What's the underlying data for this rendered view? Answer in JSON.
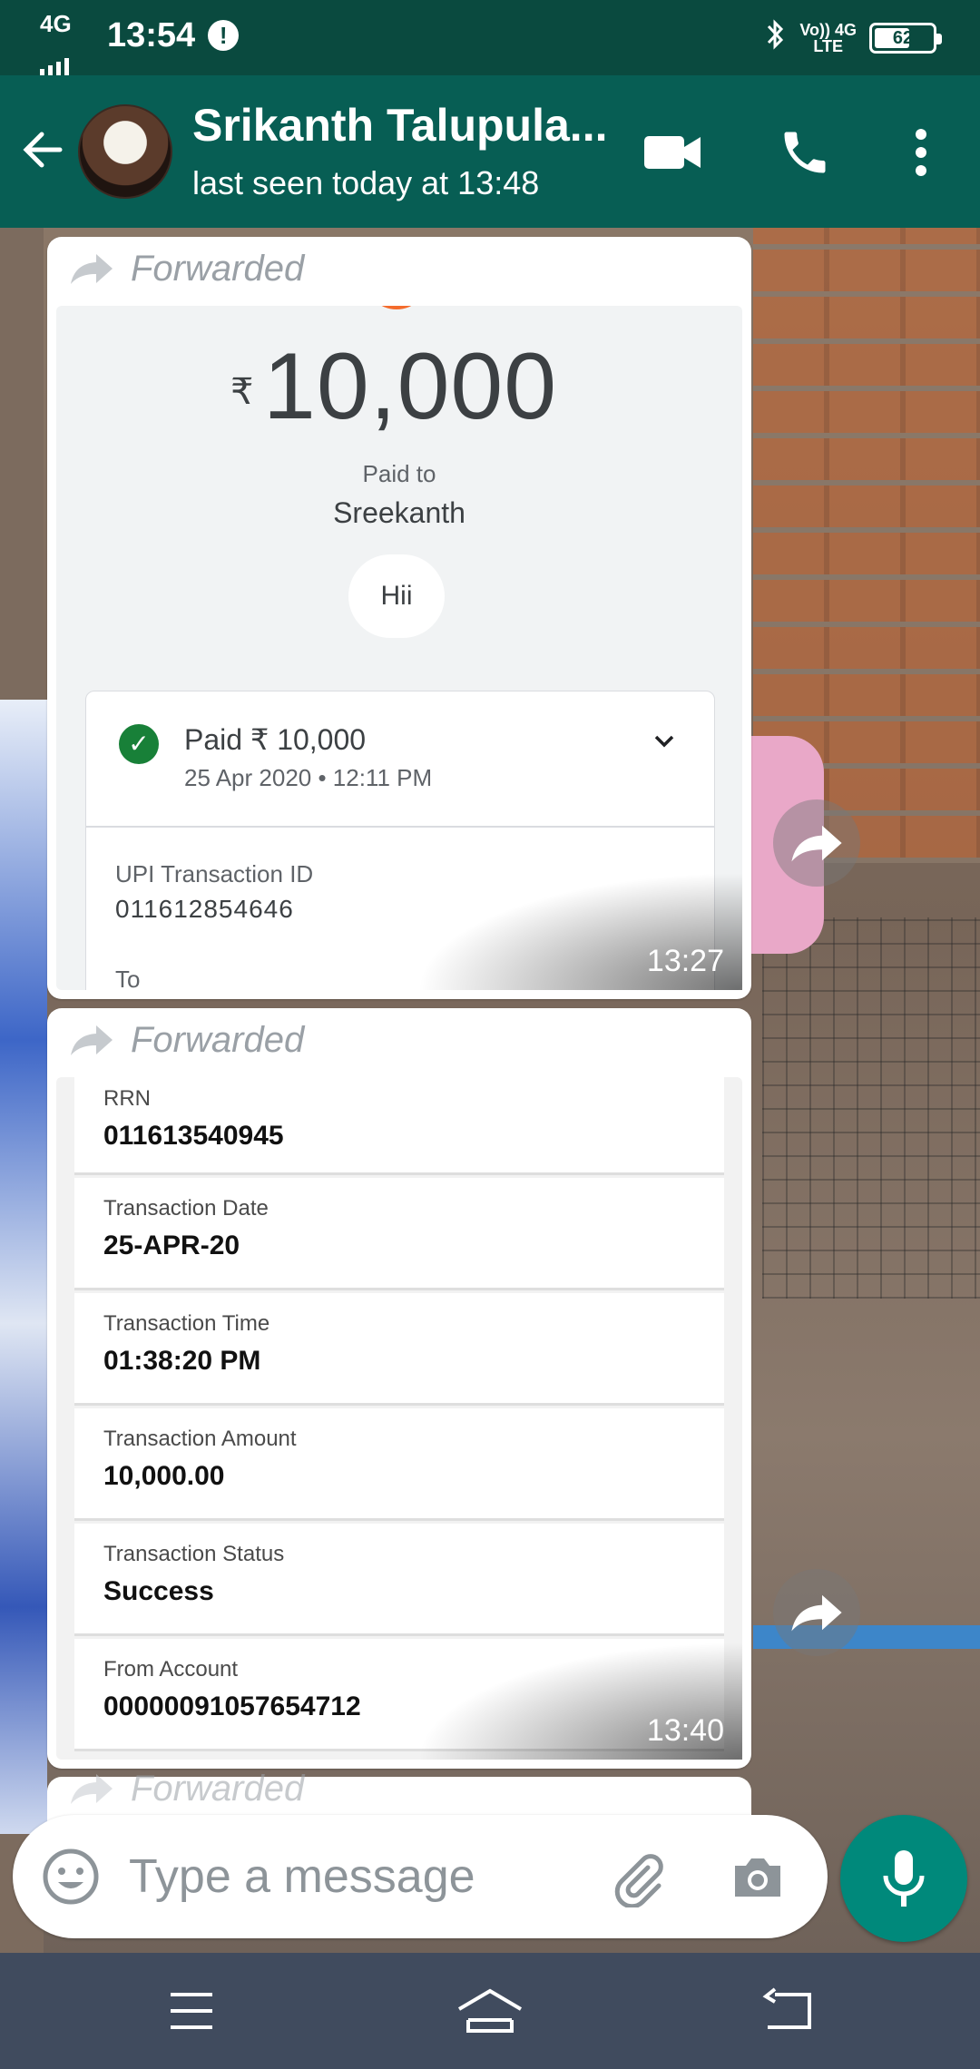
{
  "status_bar": {
    "network": "4G",
    "time": "13:54",
    "alert": "!",
    "volte_top": "Vo)) 4G",
    "volte_bottom": "LTE",
    "battery": "62",
    "battery_level": 0.62
  },
  "header": {
    "contact_name": "Srikanth Talupula...",
    "last_seen": "last seen today at 13:48"
  },
  "messages": [
    {
      "forwarded_label": "Forwarded",
      "time": "13:27",
      "image": {
        "rupee": "₹",
        "amount": "10,000",
        "paid_to_label": "Paid to",
        "payee": "Sreekanth",
        "note": "Hii",
        "paid_line": "Paid ₹ 10,000",
        "date_line": "25 Apr 2020 • 12:11 PM",
        "upi_label": "UPI Transaction ID",
        "upi_value": "011612854646",
        "to_label": "To"
      }
    },
    {
      "forwarded_label": "Forwarded",
      "time": "13:40",
      "image": {
        "rows": [
          {
            "label": "RRN",
            "value": "011613540945"
          },
          {
            "label": "Transaction Date",
            "value": "25-APR-20"
          },
          {
            "label": "Transaction Time",
            "value": "01:38:20 PM"
          },
          {
            "label": "Transaction Amount",
            "value": "10,000.00"
          },
          {
            "label": "Transaction Status",
            "value": "Success"
          },
          {
            "label": "From Account",
            "value": "00000091057654712"
          }
        ]
      }
    },
    {
      "forwarded_label": "Forwarded"
    }
  ],
  "composer": {
    "placeholder": "Type a message"
  },
  "colors": {
    "status_bar": "#0a4a3f",
    "header": "#075e54",
    "mic_button": "#00897b",
    "nav_bar": "#404b5e"
  }
}
